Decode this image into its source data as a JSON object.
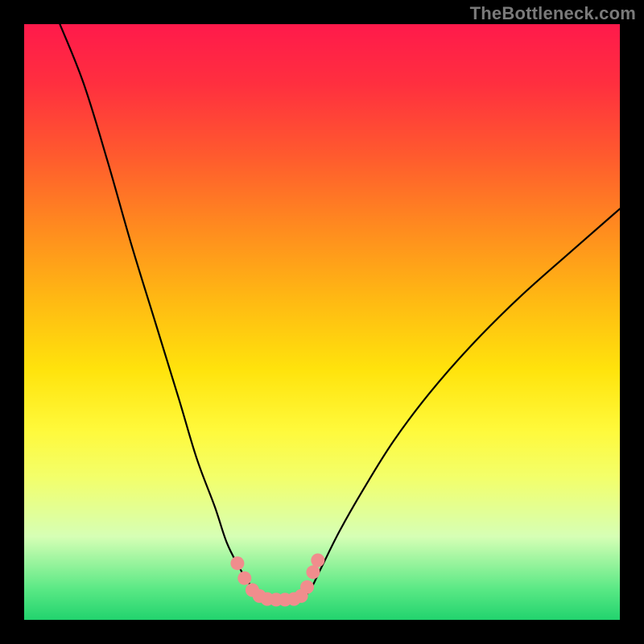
{
  "watermark": "TheBottleneck.com",
  "chart_data": {
    "type": "line",
    "title": "",
    "xlabel": "",
    "ylabel": "",
    "xlim": [
      0,
      100
    ],
    "ylim": [
      0,
      100
    ],
    "grid": false,
    "legend": false,
    "series": [
      {
        "name": "left-curve",
        "x": [
          6,
          10,
          14,
          18,
          22,
          26,
          29,
          32,
          34,
          36,
          37.5,
          39,
          40,
          40.8
        ],
        "y": [
          100,
          90,
          77,
          63,
          50,
          37,
          27,
          19,
          13,
          9,
          6.5,
          4.5,
          3.5,
          3.5
        ]
      },
      {
        "name": "right-curve",
        "x": [
          46.5,
          48,
          50,
          53,
          57,
          62,
          68,
          75,
          83,
          92,
          100
        ],
        "y": [
          3.5,
          5,
          9,
          15,
          22,
          30,
          38,
          46,
          54,
          62,
          69
        ]
      }
    ],
    "highlight_segments": {
      "name": "pink-overlay",
      "color": "#f08d8d",
      "points": [
        {
          "x": 35.8,
          "y": 9.5
        },
        {
          "x": 37.0,
          "y": 7.0
        },
        {
          "x": 38.3,
          "y": 5.0
        },
        {
          "x": 39.5,
          "y": 4.0
        },
        {
          "x": 40.8,
          "y": 3.5
        },
        {
          "x": 42.3,
          "y": 3.4
        },
        {
          "x": 43.8,
          "y": 3.4
        },
        {
          "x": 45.3,
          "y": 3.5
        },
        {
          "x": 46.5,
          "y": 4.0
        },
        {
          "x": 47.5,
          "y": 5.5
        },
        {
          "x": 48.5,
          "y": 8.0
        },
        {
          "x": 49.3,
          "y": 10.0
        }
      ]
    },
    "gradient_colors": {
      "top": "#ff1a4b",
      "mid": "#ffe30c",
      "bottom": "#22d36e"
    }
  }
}
